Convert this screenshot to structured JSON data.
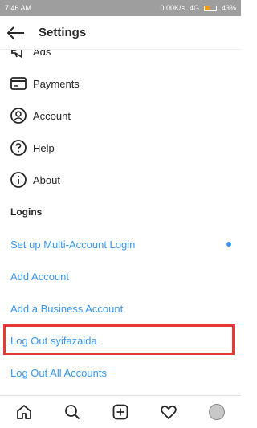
{
  "status_bar": {
    "time": "7:46 AM",
    "speed": "0.00K/s",
    "network": "4G",
    "battery_pct": "43%",
    "battery_level": 0.43
  },
  "header": {
    "title": "Settings"
  },
  "items": {
    "ads": "Ads",
    "payments": "Payments",
    "account": "Account",
    "help": "Help",
    "about": "About"
  },
  "logins": {
    "section_label": "Logins",
    "multi_account": "Set up Multi-Account Login",
    "add_account": "Add Account",
    "add_business": "Add a Business Account",
    "log_out_user": "Log Out syifazaida",
    "log_out_all": "Log Out All Accounts"
  },
  "icons": {
    "back": "arrow-left-icon",
    "ads": "megaphone-icon",
    "payments": "card-icon",
    "account": "user-circle-icon",
    "help": "question-circle-icon",
    "about": "info-circle-icon",
    "home": "home-icon",
    "search": "search-icon",
    "new_post": "plus-square-icon",
    "activity": "heart-icon",
    "profile": "avatar"
  },
  "colors": {
    "accent": "#3897f0",
    "highlight": "#e53935"
  }
}
